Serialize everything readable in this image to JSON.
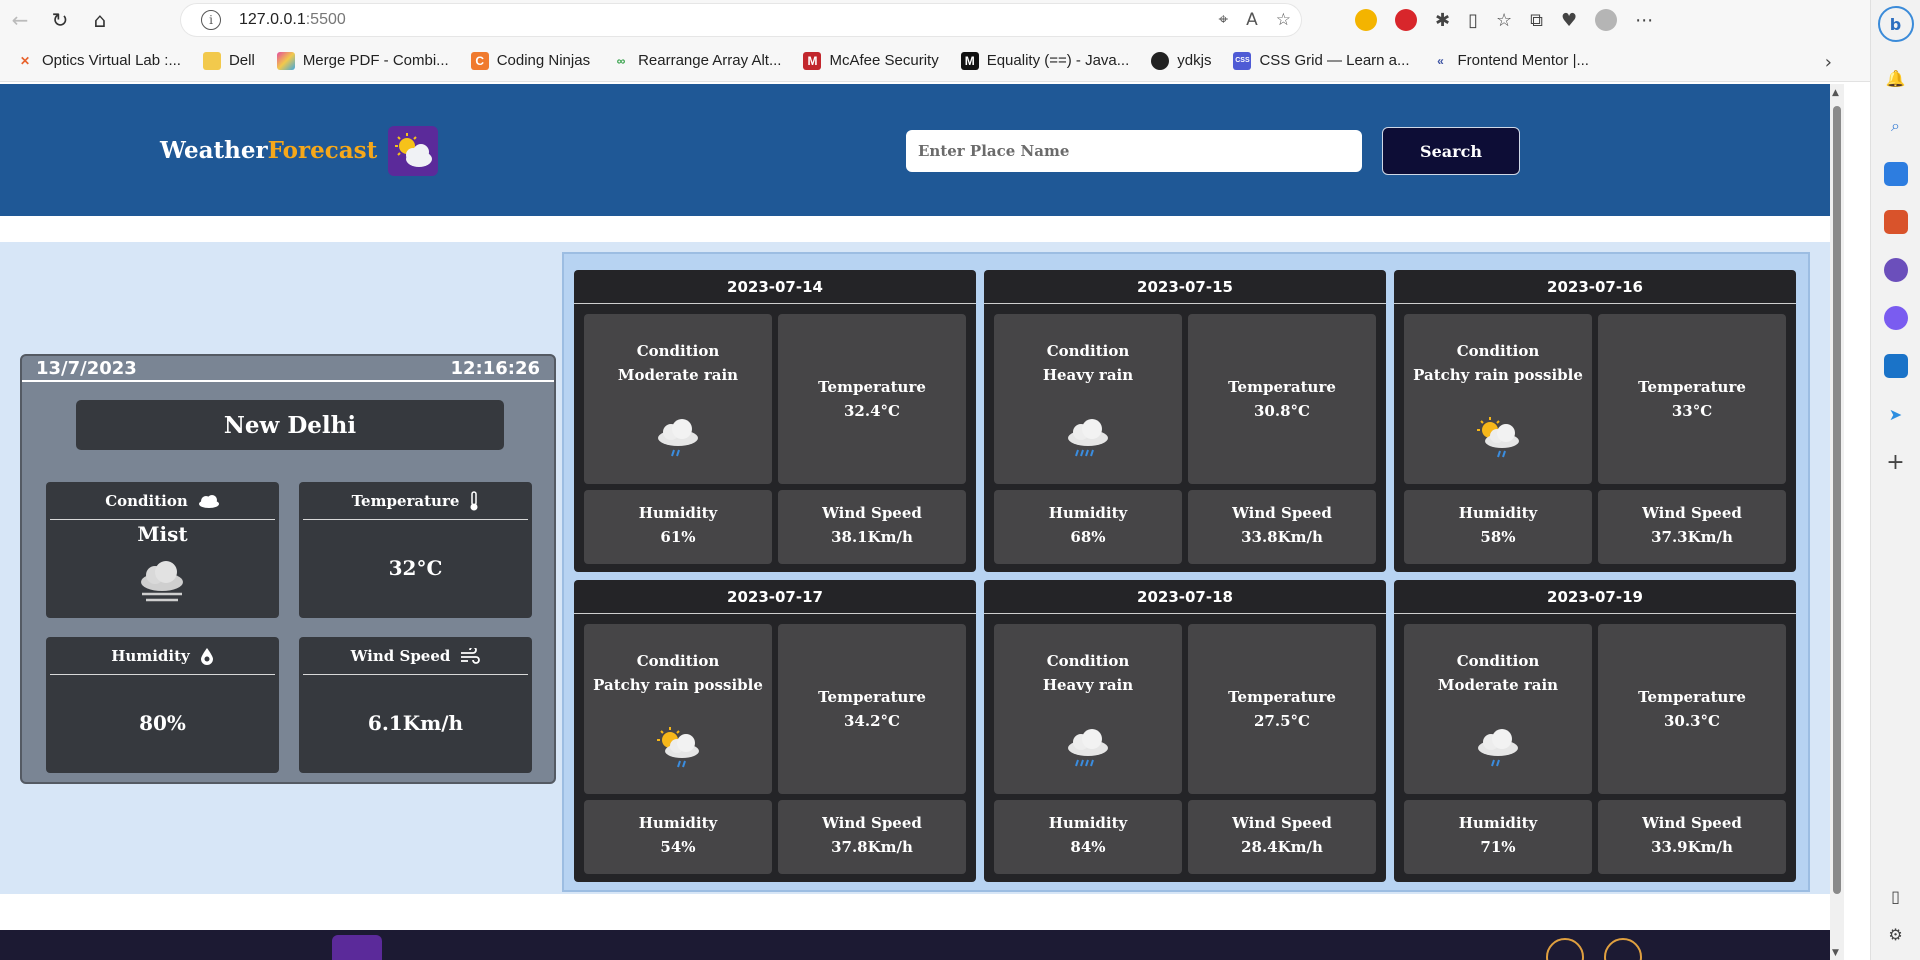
{
  "browser": {
    "url_host": "127.0.0.1",
    "url_port": ":5500",
    "bookmarks": [
      {
        "label": "Optics Virtual Lab :...",
        "color": "#e8622c",
        "glyph": "✕"
      },
      {
        "label": "Dell",
        "color": "#f2c94c",
        "glyph": "▭"
      },
      {
        "label": "Merge PDF - Combi...",
        "color": "#e44d9c",
        "glyph": "▦"
      },
      {
        "label": "Coding Ninjas",
        "color": "#f07a2d",
        "glyph": "C"
      },
      {
        "label": "Rearrange Array Alt...",
        "color": "#2f9e44",
        "glyph": "∞"
      },
      {
        "label": "McAfee Security",
        "color": "#c2272d",
        "glyph": "M"
      },
      {
        "label": "Equality (==) - Java...",
        "color": "#111111",
        "glyph": "M"
      },
      {
        "label": "ydkjs",
        "color": "#222222",
        "glyph": "●"
      },
      {
        "label": "CSS Grid — Learn a...",
        "color": "#4f5bd5",
        "glyph": "▦"
      },
      {
        "label": "Frontend Mentor |...",
        "color": "#3e54a3",
        "glyph": "«"
      }
    ]
  },
  "app": {
    "brand_main": "Weather",
    "brand_accent": "Forecast",
    "search_placeholder": "Enter Place Name",
    "search_label": "Search"
  },
  "current": {
    "date": "13/7/2023",
    "time": "12:16:26",
    "city": "New Delhi",
    "condition_label": "Condition",
    "condition_value": "Mist",
    "temperature_label": "Temperature",
    "temperature_value": "32°C",
    "humidity_label": "Humidity",
    "humidity_value": "80%",
    "wind_label": "Wind Speed",
    "wind_value": "6.1Km/h"
  },
  "forecast": [
    {
      "date": "2023-07-14",
      "condition": "Moderate rain",
      "icon": "rain-cloud-icon",
      "temperature": "32.4°C",
      "humidity": "61%",
      "wind": "38.1Km/h"
    },
    {
      "date": "2023-07-15",
      "condition": "Heavy rain",
      "icon": "heavy-rain-cloud-icon",
      "temperature": "30.8°C",
      "humidity": "68%",
      "wind": "33.8Km/h"
    },
    {
      "date": "2023-07-16",
      "condition": "Patchy rain possible",
      "icon": "sun-rain-cloud-icon",
      "temperature": "33°C",
      "humidity": "58%",
      "wind": "37.3Km/h"
    },
    {
      "date": "2023-07-17",
      "condition": "Patchy rain possible",
      "icon": "sun-rain-cloud-icon",
      "temperature": "34.2°C",
      "humidity": "54%",
      "wind": "37.8Km/h"
    },
    {
      "date": "2023-07-18",
      "condition": "Heavy rain",
      "icon": "heavy-rain-cloud-icon",
      "temperature": "27.5°C",
      "humidity": "84%",
      "wind": "28.4Km/h"
    },
    {
      "date": "2023-07-19",
      "condition": "Moderate rain",
      "icon": "rain-cloud-icon",
      "temperature": "30.3°C",
      "humidity": "71%",
      "wind": "33.9Km/h"
    }
  ],
  "forecast_labels": {
    "condition": "Condition",
    "temperature": "Temperature",
    "humidity": "Humidity",
    "wind": "Wind Speed"
  },
  "colors": {
    "header_bg": "#1f5896",
    "brand_accent": "#f6a81a",
    "search_button_bg": "#0d0d36",
    "main_bg": "#d7e6f7",
    "forecast_card_bg": "#242427"
  }
}
